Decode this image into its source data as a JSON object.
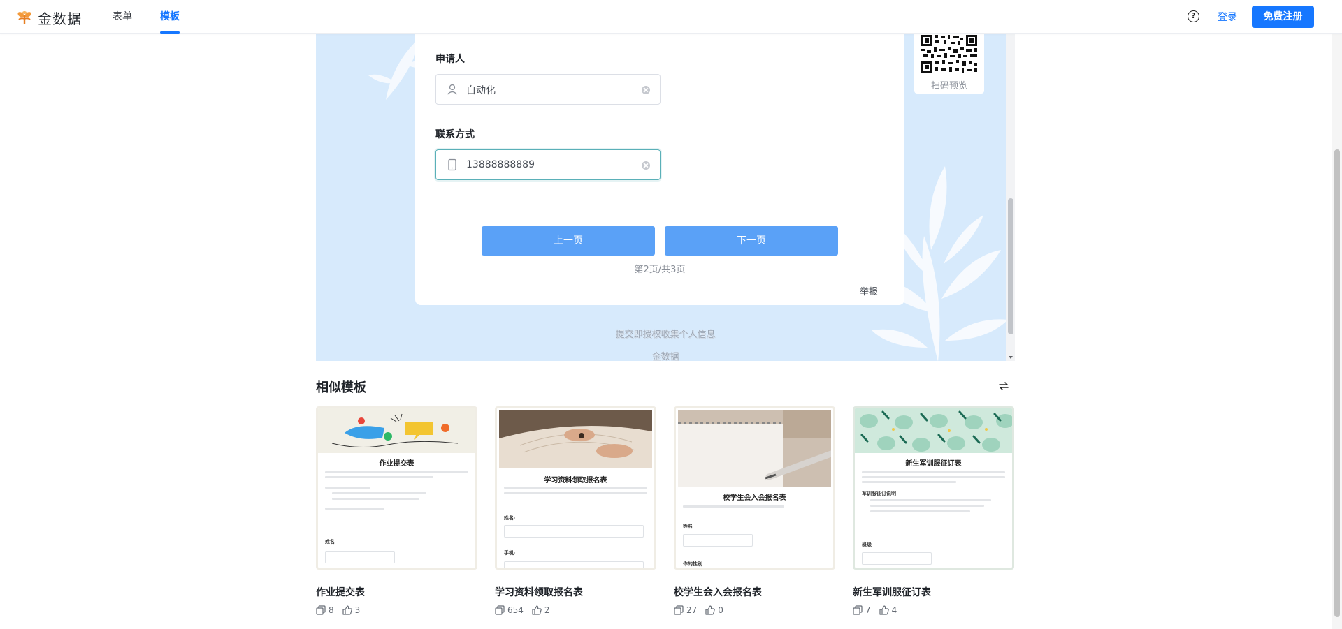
{
  "header": {
    "logo_text": "金数据",
    "nav": [
      {
        "label": "表单",
        "active": false
      },
      {
        "label": "模板",
        "active": true
      }
    ],
    "help_icon": "question-circle-icon",
    "login_label": "登录",
    "register_label": "免费注册"
  },
  "preview": {
    "fields": [
      {
        "label": "申请人",
        "value": "自动化",
        "icon": "user-icon"
      },
      {
        "label": "联系方式",
        "value": "13888888889",
        "icon": "phone-icon"
      }
    ],
    "prev_button": "上一页",
    "next_button": "下一页",
    "pager_text": "第2页/共3页",
    "report_label": "举报",
    "qr_label": "扫码预览",
    "footer_note": "提交即授权收集个人信息",
    "footer_brand": "金数据"
  },
  "similar": {
    "title": "相似模板",
    "refresh_icon": "refresh-icon",
    "templates": [
      {
        "name": "作业提交表",
        "copies": "8",
        "likes": "3",
        "thumb_title": "作业提交表",
        "thumb_field": "姓名"
      },
      {
        "name": "学习资料领取报名表",
        "copies": "654",
        "likes": "2",
        "thumb_title": "学习资料领取报名表",
        "thumb_field": "姓名:",
        "thumb_field2": "手机:"
      },
      {
        "name": "校学生会入会报名表",
        "copies": "27",
        "likes": "0",
        "thumb_title": "校学生会入会报名表",
        "thumb_field": "姓名",
        "thumb_field2": "你的性别"
      },
      {
        "name": "新生军训服征订表",
        "copies": "7",
        "likes": "4",
        "thumb_title": "新生军训服征订表",
        "thumb_field": "班级",
        "thumb_sub": "军训服征订说明"
      }
    ]
  },
  "colors": {
    "accent": "#1677ff",
    "preview_bg": "#d7eafc",
    "page_button": "#5aa1f7"
  }
}
